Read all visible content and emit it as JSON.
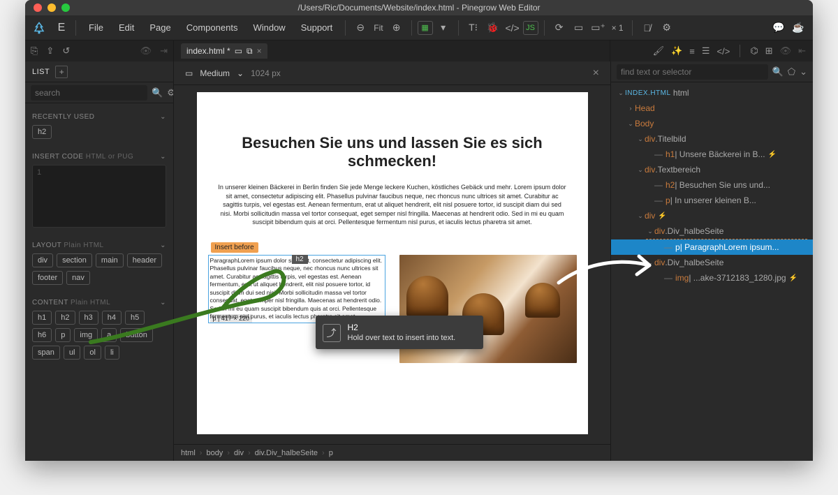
{
  "title": "/Users/Ric/Documents/Website/index.html - Pinegrow Web Editor",
  "menu": [
    "File",
    "Edit",
    "Page",
    "Components",
    "Window",
    "Support"
  ],
  "toolbar": {
    "fit": "Fit",
    "times": "× 1"
  },
  "tab": {
    "name": "index.html *"
  },
  "view": {
    "size_label": "Medium",
    "width": "1024 px"
  },
  "left": {
    "list": "LIST",
    "search_ph": "search",
    "recent": "RECENTLY USED",
    "recent_items": [
      "h2"
    ],
    "insert": "INSERT CODE",
    "insert_hint": "HTML or PUG",
    "code_ln": "1",
    "layout": "LAYOUT",
    "layout_hint": "Plain HTML",
    "layout_items": [
      "div",
      "section",
      "main",
      "header",
      "footer",
      "nav"
    ],
    "content": "CONTENT",
    "content_hint": "Plain HTML",
    "content_items": [
      "h1",
      "h2",
      "h3",
      "h4",
      "h5",
      "h6",
      "p",
      "img",
      "a",
      "button",
      "span",
      "ul",
      "ol",
      "li"
    ]
  },
  "page": {
    "heading": "Besuchen Sie uns und lassen Sie es sich schmecken!",
    "intro": "In unserer kleinen Bäckerei in Berlin finden Sie jede Menge leckere Kuchen, köstliches Gebäck und mehr.  Lorem ipsum dolor sit amet, consectetur adipiscing elit. Phasellus pulvinar faucibus neque, nec rhoncus nunc ultrices sit amet. Curabitur ac sagittis turpis, vel egestas est. Aenean fermentum, erat ut aliquet hendrerit, elit nisl posuere tortor, id suscipit diam dui sed nisi. Morbi sollicitudin massa vel tortor consequat, eget semper nisl fringilla. Maecenas at hendrerit odio. Sed in mi eu quam suscipit bibendum quis at orci. Pellentesque fermentum nisl purus, et iaculis lectus pharetra sit amet.",
    "insert_before": "Insert before",
    "chip": "h2",
    "col_p": "ParagraphLorem ipsum dolor sit amet, consectetur adipiscing elit. Phasellus pulvinar faucibus neque, nec rhoncus nunc ultrices sit amet. Curabitur ac sagittis turpis, vel egestas est. Aenean fermentum, erat ut aliquet hendrerit, elit nisl posuere tortor, id suscipit diam dui sed nisi. Morbi sollicitudin massa vel tortor consequat, eget semper nisl fringilla. Maecenas at hendrerit odio. Sed in mi eu quam suscipit bibendum quis at orci. Pellentesque fermentum nisl purus, et iaculis lectus pharetra sit amet.",
    "dim": "p | 417 × 220"
  },
  "tooltip": {
    "title": "H2",
    "body": "Hold over text to insert into text."
  },
  "crumb": [
    "html",
    "body",
    "div",
    "div.Div_halbeSeite",
    "p"
  ],
  "tree": {
    "file": "INDEX.HTML",
    "file_tag": "html",
    "rows": [
      {
        "d": 1,
        "c": ">",
        "l": "Head",
        "t": ""
      },
      {
        "d": 1,
        "c": "v",
        "l": "Body",
        "t": ""
      },
      {
        "d": 2,
        "c": "v",
        "l": "div",
        "t": ".Titelbild"
      },
      {
        "d": 3,
        "c": "-",
        "l": "h1",
        "t": " | Unsere Bäckerei in B...",
        "lg": true
      },
      {
        "d": 2,
        "c": "v",
        "l": "div",
        "t": ".Textbereich"
      },
      {
        "d": 3,
        "c": "-",
        "l": "h2",
        "t": " | Besuchen Sie uns und..."
      },
      {
        "d": 3,
        "c": "-",
        "l": "p",
        "t": " | In unserer kleinen B..."
      },
      {
        "d": 2,
        "c": "v",
        "l": "div",
        "t": "",
        "lg": true
      },
      {
        "d": 3,
        "c": "v",
        "l": "div",
        "t": ".Div_halbeSeite",
        "hl": "dash"
      },
      {
        "d": 4,
        "c": "-",
        "l": "p",
        "t": " | ParagraphLorem ipsum...",
        "sel": true
      },
      {
        "d": 3,
        "c": "v",
        "l": "div",
        "t": ".Div_halbeSeite"
      },
      {
        "d": 4,
        "c": "-",
        "l": "img",
        "t": " | ...ake-3712183_1280.jpg",
        "lg": true
      }
    ]
  },
  "right_search_ph": "find text or selector"
}
